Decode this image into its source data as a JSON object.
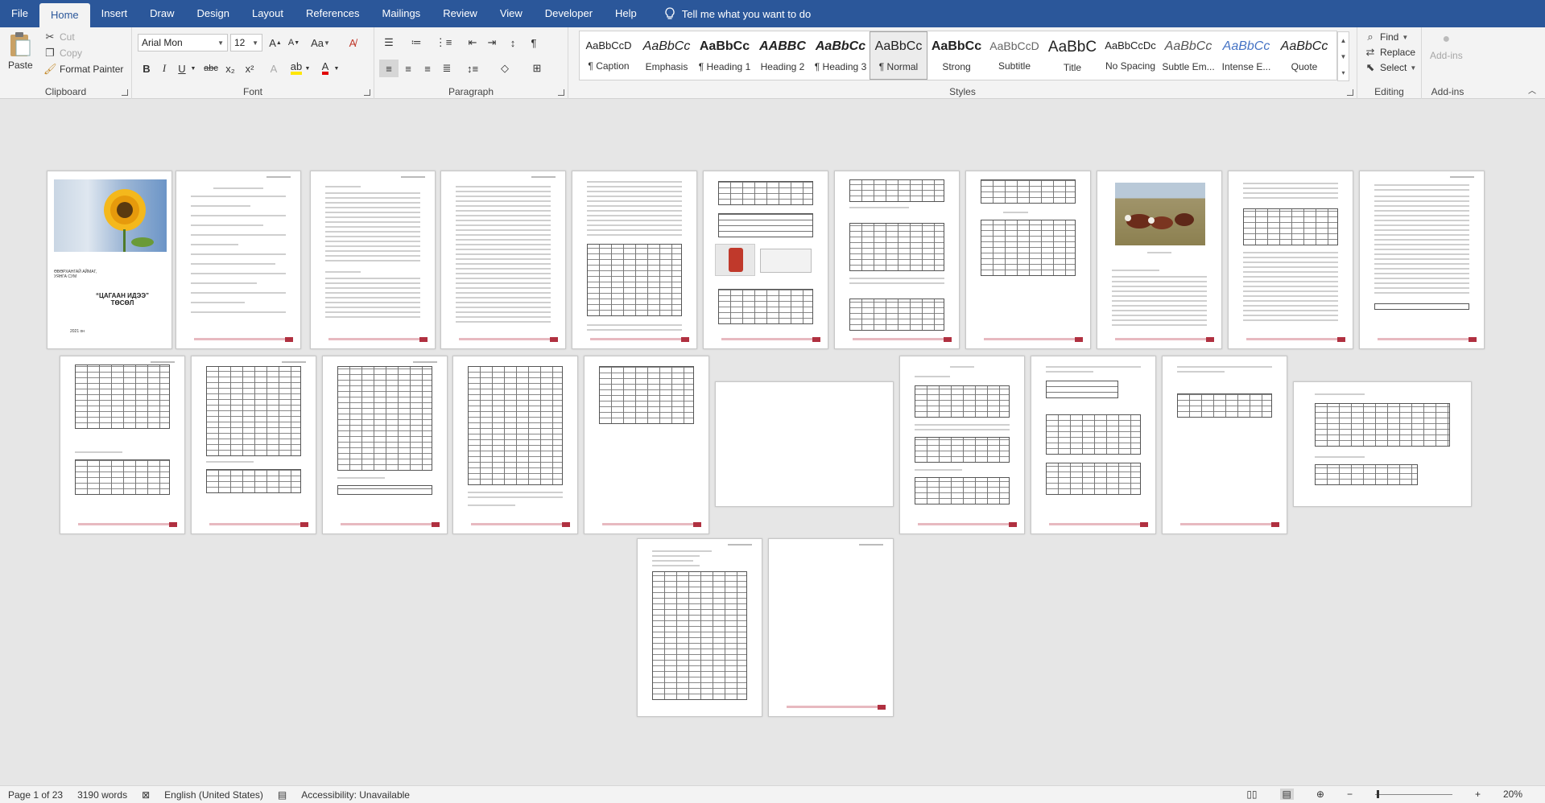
{
  "tabs": [
    "File",
    "Home",
    "Insert",
    "Draw",
    "Design",
    "Layout",
    "References",
    "Mailings",
    "Review",
    "View",
    "Developer",
    "Help"
  ],
  "active_tab": "Home",
  "tell_me": "Tell me what you want to do",
  "clipboard": {
    "paste": "Paste",
    "cut": "Cut",
    "copy": "Copy",
    "format_painter": "Format Painter",
    "label": "Clipboard"
  },
  "font": {
    "name": "Arial Mon",
    "size": "12",
    "label": "Font",
    "bold": "B",
    "italic": "I",
    "underline": "U",
    "strike": "abc",
    "sub": "x₂",
    "sup": "x²",
    "grow": "A",
    "shrink": "A",
    "case": "Aa"
  },
  "paragraph": {
    "label": "Paragraph"
  },
  "styles": {
    "label": "Styles",
    "items": [
      {
        "preview": "AaBbCcD",
        "name": "¶ Caption"
      },
      {
        "preview": "AaBbCc",
        "name": "Emphasis"
      },
      {
        "preview": "AaBbCc",
        "name": "¶ Heading 1"
      },
      {
        "preview": "AABBC",
        "name": "Heading 2"
      },
      {
        "preview": "AaBbCc",
        "name": "¶ Heading 3"
      },
      {
        "preview": "AaBbCc",
        "name": "¶ Normal"
      },
      {
        "preview": "AaBbCc",
        "name": "Strong"
      },
      {
        "preview": "AaBbCcD",
        "name": "Subtitle"
      },
      {
        "preview": "AaBbC",
        "name": "Title"
      },
      {
        "preview": "AaBbCcDc",
        "name": "No Spacing"
      },
      {
        "preview": "AaBbCc",
        "name": "Subtle Em..."
      },
      {
        "preview": "AaBbCc",
        "name": "Intense E..."
      },
      {
        "preview": "AaBbCc",
        "name": "Quote"
      }
    ]
  },
  "editing": {
    "find": "Find",
    "replace": "Replace",
    "select": "Select",
    "label": "Editing"
  },
  "addins": {
    "btn": "Add-ins",
    "label": "Add-ins"
  },
  "cover": {
    "org": "ӨВӨРХАНГАЙ АЙМАГ, УЯНГА СУМ",
    "title": "“ЦАГААН ИДЭЭ” ТӨСӨЛ",
    "year": "2021 он"
  },
  "status": {
    "page": "Page 1 of 23",
    "words": "3190 words",
    "language": "English (United States)",
    "accessibility": "Accessibility: Unavailable",
    "zoom": "20%"
  }
}
